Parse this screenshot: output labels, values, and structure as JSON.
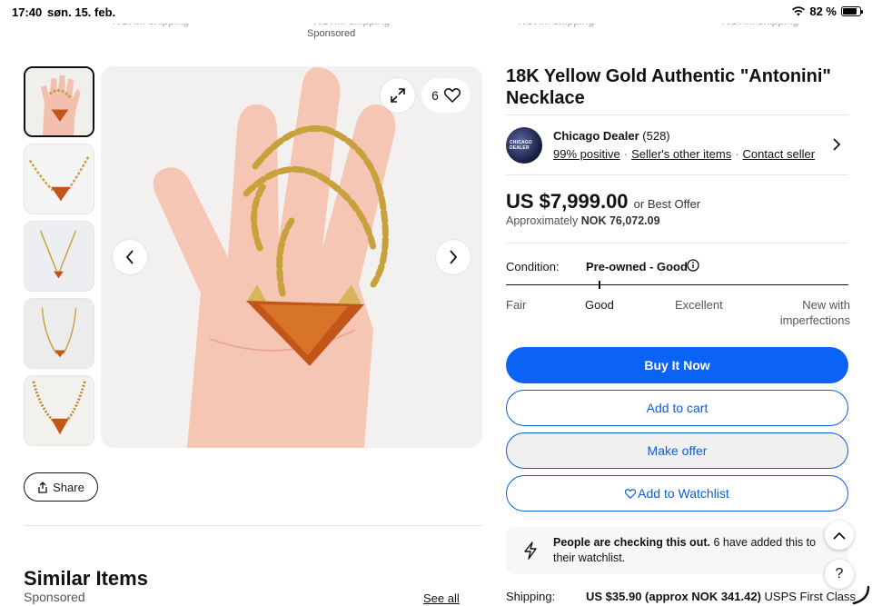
{
  "status_bar": {
    "time": "17:40",
    "date": "søn. 15. feb.",
    "battery": "82 %",
    "battery_level": 0.82
  },
  "top_carousel": {
    "remnants": [
      "NOK... shipping",
      "NOK... shipping",
      "NOK... shipping",
      "NOK... shipping"
    ],
    "sponsored": "Sponsored"
  },
  "gallery": {
    "thumb_count": 5,
    "photo_count": "6"
  },
  "share_label": "Share",
  "similar": {
    "title": "Similar Items",
    "sponsored": "Sponsored",
    "see_all": "See all"
  },
  "listing": {
    "title": "18K Yellow Gold Authentic \"Antonini\" Necklace",
    "seller": {
      "name": "Chicago Dealer",
      "feedback_count": "(528)",
      "positive": "99% positive",
      "other_items": "Seller's other items",
      "contact": "Contact seller",
      "avatar_text": "CHICAGO DEALER"
    },
    "price": "US $7,999.00",
    "best_offer": "or Best Offer",
    "approx_label": "Approximately",
    "approx_value": "NOK 76,072.09",
    "condition_label": "Condition:",
    "condition_value": "Pre-owned - Good",
    "condition_scale": [
      "Fair",
      "Good",
      "Excellent",
      "New with imperfections"
    ],
    "buttons": {
      "buy_now": "Buy It Now",
      "add_cart": "Add to cart",
      "make_offer": "Make offer",
      "watchlist": "Add to Watchlist"
    },
    "notice": {
      "bold": "People are checking this out.",
      "text": "6 have added this to their watchlist."
    },
    "shipping_label": "Shipping:",
    "shipping_bold": "US $35.90 (approx NOK 341.42)",
    "shipping_rest": "USPS First Class"
  },
  "colors": {
    "primary": "#0b63f6",
    "link": "#0b5ed7",
    "gold": "#c9a13c",
    "amber": "#c2561a"
  }
}
